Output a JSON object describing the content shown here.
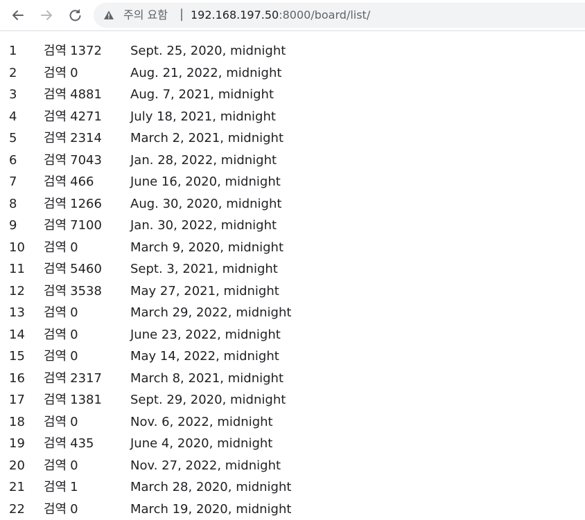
{
  "browser": {
    "back_icon": "arrow-left-icon",
    "forward_icon": "arrow-right-icon",
    "reload_icon": "reload-icon",
    "security_icon": "warning-triangle-icon",
    "security_text": "주의 요함",
    "separator": "|",
    "url_host": "192.168.197.50",
    "url_path": ":8000/board/list/"
  },
  "rows": [
    {
      "no": "1",
      "name": "검역",
      "count": "1372",
      "date": "Sept. 25, 2020, midnight"
    },
    {
      "no": "2",
      "name": "검역",
      "count": "0",
      "date": "Aug. 21, 2022, midnight"
    },
    {
      "no": "3",
      "name": "검역",
      "count": "4881",
      "date": "Aug. 7, 2021, midnight"
    },
    {
      "no": "4",
      "name": "검역",
      "count": "4271",
      "date": "July 18, 2021, midnight"
    },
    {
      "no": "5",
      "name": "검역",
      "count": "2314",
      "date": "March 2, 2021, midnight"
    },
    {
      "no": "6",
      "name": "검역",
      "count": "7043",
      "date": "Jan. 28, 2022, midnight"
    },
    {
      "no": "7",
      "name": "검역",
      "count": "466",
      "date": "June 16, 2020, midnight"
    },
    {
      "no": "8",
      "name": "검역",
      "count": "1266",
      "date": "Aug. 30, 2020, midnight"
    },
    {
      "no": "9",
      "name": "검역",
      "count": "7100",
      "date": "Jan. 30, 2022, midnight"
    },
    {
      "no": "10",
      "name": "검역",
      "count": "0",
      "date": "March 9, 2020, midnight"
    },
    {
      "no": "11",
      "name": "검역",
      "count": "5460",
      "date": "Sept. 3, 2021, midnight"
    },
    {
      "no": "12",
      "name": "검역",
      "count": "3538",
      "date": "May 27, 2021, midnight"
    },
    {
      "no": "13",
      "name": "검역",
      "count": "0",
      "date": "March 29, 2022, midnight"
    },
    {
      "no": "14",
      "name": "검역",
      "count": "0",
      "date": "June 23, 2022, midnight"
    },
    {
      "no": "15",
      "name": "검역",
      "count": "0",
      "date": "May 14, 2022, midnight"
    },
    {
      "no": "16",
      "name": "검역",
      "count": "2317",
      "date": "March 8, 2021, midnight"
    },
    {
      "no": "17",
      "name": "검역",
      "count": "1381",
      "date": "Sept. 29, 2020, midnight"
    },
    {
      "no": "18",
      "name": "검역",
      "count": "0",
      "date": "Nov. 6, 2022, midnight"
    },
    {
      "no": "19",
      "name": "검역",
      "count": "435",
      "date": "June 4, 2020, midnight"
    },
    {
      "no": "20",
      "name": "검역",
      "count": "0",
      "date": "Nov. 27, 2022, midnight"
    },
    {
      "no": "21",
      "name": "검역",
      "count": "1",
      "date": "March 28, 2020, midnight"
    },
    {
      "no": "22",
      "name": "검역",
      "count": "0",
      "date": "March 19, 2020, midnight"
    }
  ]
}
